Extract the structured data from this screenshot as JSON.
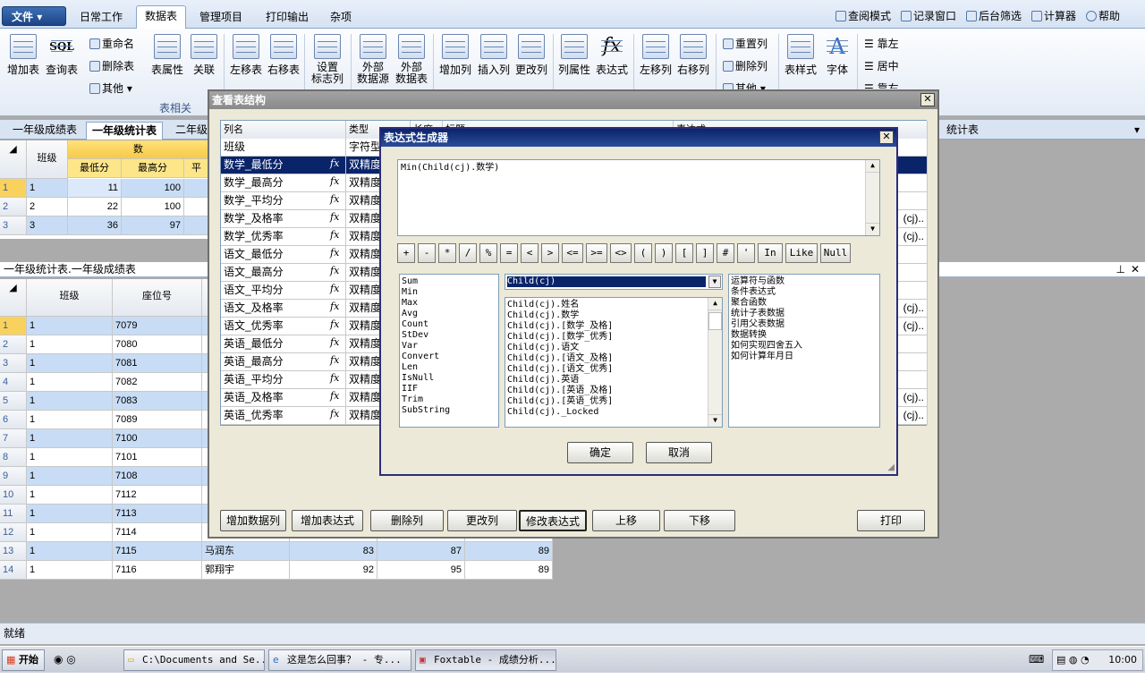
{
  "ribbon_tabs": {
    "file": "文件",
    "tabs": [
      "日常工作",
      "数据表",
      "管理项目",
      "打印输出",
      "杂项"
    ],
    "active_index": 1,
    "right_items": [
      "查阅模式",
      "记录窗口",
      "后台筛选",
      "计算器",
      "帮助"
    ]
  },
  "ribbon": {
    "add_table": "增加表",
    "query_table": "查询表",
    "rename": "重命名",
    "delete_table": "删除表",
    "other": "其他",
    "table_props": "表属性",
    "relations": "关联",
    "left_table": "左移表",
    "right_table": "右移表",
    "set_title_col": "设置",
    "set_title_col2": "标志列",
    "ext_source": "外部",
    "ext_source2": "数据源",
    "ext_table": "外部",
    "ext_table2": "数据表",
    "group_table": "表相关",
    "add_col": "增加列",
    "insert_col": "插入列",
    "change_col": "更改列",
    "col_props": "列属性",
    "expression": "表达式",
    "left_col": "左移列",
    "right_col": "右移列",
    "reset_col": "重置列",
    "delete_col": "删除列",
    "other2": "其他",
    "table_style": "表样式",
    "font": "字体",
    "align_left": "靠左",
    "align_center": "居中",
    "align_right": "靠右"
  },
  "sheet_tabs": [
    "一年级成绩表",
    "一年级统计表",
    "二年级"
  ],
  "sheet_tab_right": "统计表",
  "grid1": {
    "col_class": "班级",
    "group_header": "数",
    "cols": [
      "最低分",
      "最高分",
      "平"
    ],
    "rows": [
      {
        "n": "1",
        "cls": "1",
        "min": "11",
        "max": "100"
      },
      {
        "n": "2",
        "cls": "2",
        "min": "22",
        "max": "100"
      },
      {
        "n": "3",
        "cls": "3",
        "min": "36",
        "max": "97"
      }
    ]
  },
  "grid2": {
    "caption": "一年级统计表.一年级成绩表",
    "col_class": "班级",
    "col_seat": "座位号",
    "rows": [
      {
        "n": "1",
        "cls": "1",
        "seat": "7079",
        "name": "",
        "a": "",
        "b": "",
        "c": ""
      },
      {
        "n": "2",
        "cls": "1",
        "seat": "7080",
        "name": "",
        "a": "",
        "b": "",
        "c": ""
      },
      {
        "n": "3",
        "cls": "1",
        "seat": "7081",
        "name": "",
        "a": "",
        "b": "",
        "c": ""
      },
      {
        "n": "4",
        "cls": "1",
        "seat": "7082",
        "name": "",
        "a": "",
        "b": "",
        "c": ""
      },
      {
        "n": "5",
        "cls": "1",
        "seat": "7083",
        "name": "",
        "a": "",
        "b": "",
        "c": ""
      },
      {
        "n": "6",
        "cls": "1",
        "seat": "7089",
        "name": "",
        "a": "",
        "b": "",
        "c": ""
      },
      {
        "n": "7",
        "cls": "1",
        "seat": "7100",
        "name": "",
        "a": "",
        "b": "",
        "c": ""
      },
      {
        "n": "8",
        "cls": "1",
        "seat": "7101",
        "name": "",
        "a": "",
        "b": "",
        "c": ""
      },
      {
        "n": "9",
        "cls": "1",
        "seat": "7108",
        "name": "",
        "a": "",
        "b": "",
        "c": ""
      },
      {
        "n": "10",
        "cls": "1",
        "seat": "7112",
        "name": "",
        "a": "",
        "b": "",
        "c": ""
      },
      {
        "n": "11",
        "cls": "1",
        "seat": "7113",
        "name": "",
        "a": "",
        "b": "",
        "c": ""
      },
      {
        "n": "12",
        "cls": "1",
        "seat": "7114",
        "name": "",
        "a": "",
        "b": "",
        "c": ""
      },
      {
        "n": "13",
        "cls": "1",
        "seat": "7115",
        "name": "马润东",
        "a": "83",
        "b": "87",
        "c": "89"
      },
      {
        "n": "14",
        "cls": "1",
        "seat": "7116",
        "name": "郭翔宇",
        "a": "92",
        "b": "95",
        "c": "89"
      }
    ]
  },
  "dlg1": {
    "title": "查看表结构",
    "col_name": "列名",
    "col_type": "类型",
    "col_len": "长度",
    "col_title": "标题",
    "col_expr": "表达式",
    "rows": [
      {
        "name": "班级",
        "type": "字符型",
        "fx": false
      },
      {
        "name": "数学_最低分",
        "type": "双精度",
        "fx": true
      },
      {
        "name": "数学_最高分",
        "type": "双精度",
        "fx": true
      },
      {
        "name": "数学_平均分",
        "type": "双精度",
        "fx": true
      },
      {
        "name": "数学_及格率",
        "type": "双精度",
        "fx": true
      },
      {
        "name": "数学_优秀率",
        "type": "双精度",
        "fx": true
      },
      {
        "name": "语文_最低分",
        "type": "双精度",
        "fx": true
      },
      {
        "name": "语文_最高分",
        "type": "双精度",
        "fx": true
      },
      {
        "name": "语文_平均分",
        "type": "双精度",
        "fx": true
      },
      {
        "name": "语文_及格率",
        "type": "双精度",
        "fx": true
      },
      {
        "name": "语文_优秀率",
        "type": "双精度",
        "fx": true
      },
      {
        "name": "英语_最低分",
        "type": "双精度",
        "fx": true
      },
      {
        "name": "英语_最高分",
        "type": "双精度",
        "fx": true
      },
      {
        "name": "英语_平均分",
        "type": "双精度",
        "fx": true
      },
      {
        "name": "英语_及格率",
        "type": "双精度",
        "fx": true
      },
      {
        "name": "英语_优秀率",
        "type": "双精度",
        "fx": true
      }
    ],
    "expr_tail": "(cj)..",
    "buttons": [
      "增加数据列",
      "增加表达式",
      "删除列",
      "更改列",
      "修改表达式",
      "上移",
      "下移",
      "打印"
    ]
  },
  "dlg2": {
    "title": "表达式生成器",
    "expression": "Min(Child(cj).数学)",
    "operators": [
      "+",
      "-",
      "*",
      "/",
      "%",
      "=",
      "<",
      ">",
      "<=",
      ">=",
      "<>",
      "(",
      ")",
      "[",
      "]",
      "#",
      "'",
      "In",
      "Like",
      "Null"
    ],
    "functions": [
      "Sum",
      "Min",
      "Max",
      "Avg",
      "Count",
      "StDev",
      "Var",
      "Convert",
      "Len",
      "IsNull",
      "IIF",
      "Trim",
      "SubString"
    ],
    "combo_value": "Child(cj)",
    "fields": [
      "Child(cj).姓名",
      "Child(cj).数学",
      "Child(cj).[数学_及格]",
      "Child(cj).[数学_优秀]",
      "Child(cj).语文",
      "Child(cj).[语文_及格]",
      "Child(cj).[语文_优秀]",
      "Child(cj).英语",
      "Child(cj).[英语_及格]",
      "Child(cj).[英语_优秀]",
      "Child(cj)._Locked"
    ],
    "help_items": [
      "运算符与函数",
      "条件表达式",
      "聚合函数",
      "统计子表数据",
      "引用父表数据",
      "数据转换",
      "如何实现四舍五入",
      "如何计算年月日"
    ],
    "ok": "确定",
    "cancel": "取消"
  },
  "status": "就绪",
  "taskbar": {
    "start": "开始",
    "tasks": [
      "C:\\Documents and Se...",
      "这是怎么回事？ - 专...",
      "Foxtable - 成绩分析..."
    ],
    "clock": "10:00"
  }
}
